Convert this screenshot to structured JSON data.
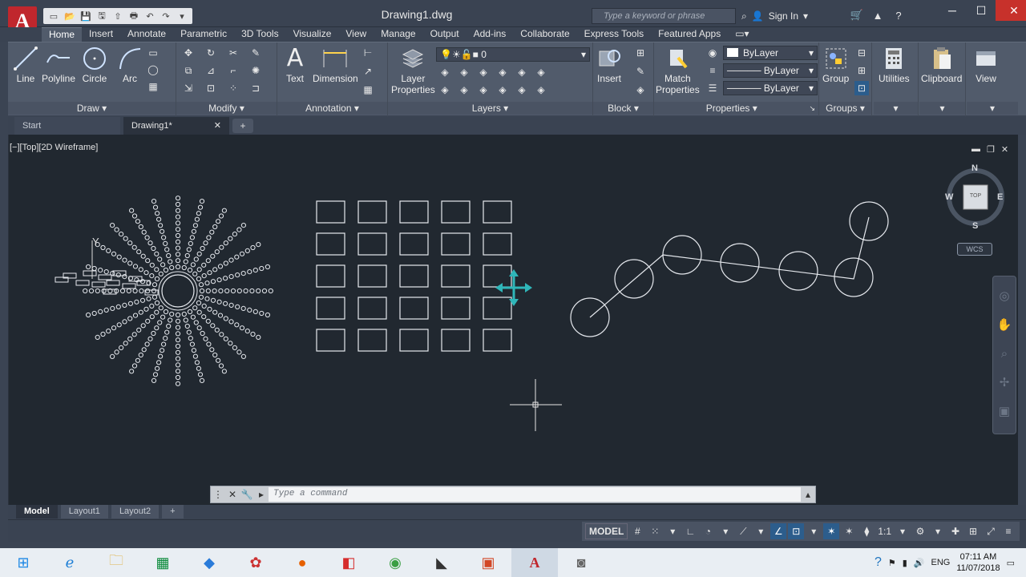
{
  "title_bar": {
    "document_title": "Drawing1.dwg",
    "search_placeholder": "Type a keyword or phrase",
    "sign_in": "Sign In",
    "app_logo": "A"
  },
  "ribbon_tabs": [
    "Home",
    "Insert",
    "Annotate",
    "Parametric",
    "3D Tools",
    "Visualize",
    "View",
    "Manage",
    "Output",
    "Add-ins",
    "Collaborate",
    "Express Tools",
    "Featured Apps"
  ],
  "active_tab": "Home",
  "panels": {
    "draw": {
      "title": "Draw",
      "buttons": [
        "Line",
        "Polyline",
        "Circle",
        "Arc"
      ]
    },
    "modify": {
      "title": "Modify"
    },
    "annotation": {
      "title": "Annotation",
      "buttons": [
        "Text",
        "Dimension"
      ]
    },
    "layers": {
      "title": "Layers",
      "layer_properties": "Layer\nProperties",
      "current_layer": "0"
    },
    "block": {
      "title": "Block",
      "insert": "Insert"
    },
    "properties": {
      "title": "Properties",
      "match_properties": "Match\nProperties",
      "color": "ByLayer",
      "linetype": "ByLayer",
      "lineweight": "ByLayer"
    },
    "groups": {
      "title": "Groups",
      "group": "Group"
    },
    "utilities": {
      "label": "Utilities"
    },
    "clipboard": {
      "label": "Clipboard"
    },
    "view": {
      "label": "View"
    }
  },
  "doc_tabs": [
    {
      "label": "Start"
    },
    {
      "label": "Drawing1*"
    }
  ],
  "viewport": {
    "controls": "[−][Top][2D Wireframe]",
    "viewcube": {
      "n": "N",
      "s": "S",
      "e": "E",
      "w": "W",
      "face": "TOP"
    },
    "wcs": "WCS"
  },
  "command_line": {
    "placeholder": "Type a command"
  },
  "layout_tabs": [
    "Model",
    "Layout1",
    "Layout2"
  ],
  "status_bar": {
    "model": "MODEL",
    "scale": "1:1"
  },
  "taskbar": {
    "lang": "ENG",
    "time": "07:11 AM",
    "date": "11/07/2018"
  },
  "colors": {
    "canvas": "#212830",
    "ribbon": "#515b6b",
    "accent_move": "#2fb6b9",
    "geometry": "#e6e9ee"
  }
}
